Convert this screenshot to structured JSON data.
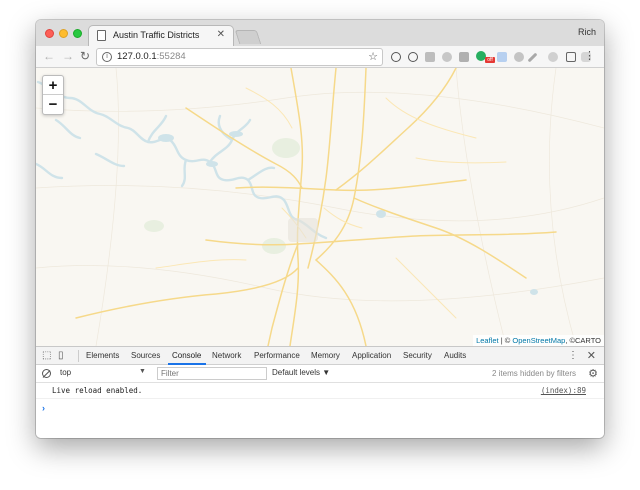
{
  "window": {
    "tab_title": "Austin Traffic Districts",
    "profile_name": "Rich"
  },
  "toolbar": {
    "url_host": "127.0.0.1",
    "url_port": ":55284",
    "back_icon": "arrow-left-icon",
    "forward_icon": "arrow-right-icon",
    "reload_icon": "reload-icon",
    "bookmark_icon": "star-icon",
    "extension_badge": "off"
  },
  "map": {
    "zoom_in_label": "+",
    "zoom_out_label": "−",
    "attribution_leaflet": "Leaflet",
    "attribution_sep": " | © ",
    "attribution_osm": "OpenStreetMap",
    "attribution_carto": ", ©CARTO",
    "colors": {
      "water": "#cfe3e9",
      "roads": "#f6d98a",
      "land": "#f9f7f2"
    }
  },
  "devtools": {
    "tabs": [
      "Elements",
      "Sources",
      "Console",
      "Network",
      "Performance",
      "Memory",
      "Application",
      "Security",
      "Audits"
    ],
    "active_tab": "Console",
    "context": "top",
    "filter_placeholder": "Filter",
    "levels_label": "Default levels ▼",
    "hidden_count": "2 items hidden by filters",
    "console_message": "Live reload enabled.",
    "console_source": "(index):89",
    "prompt_symbol": "›"
  }
}
